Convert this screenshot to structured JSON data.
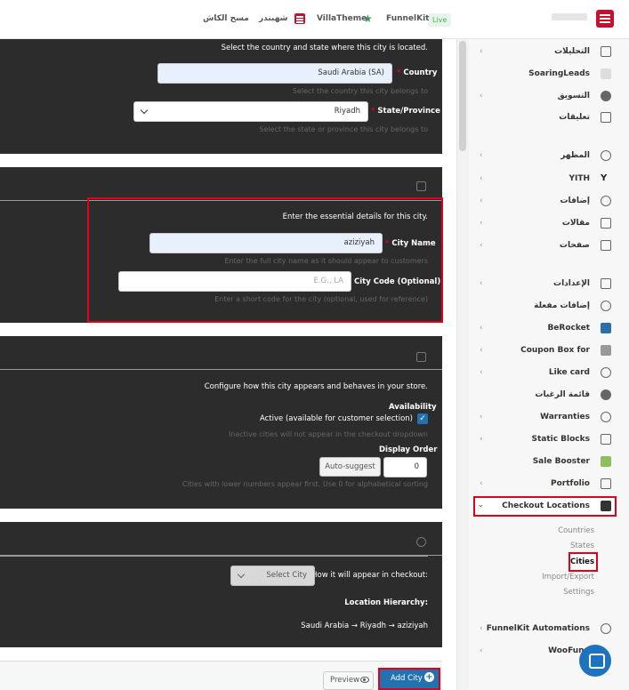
{
  "topbar": {
    "live_badge": "Live",
    "links": [
      "FunnelKit",
      "VillaTheme",
      "شهبندر",
      "مسح الكاش"
    ]
  },
  "sidebar": {
    "items": [
      {
        "label": "التحليلات",
        "icon": "analytics-icon"
      },
      {
        "label": "SoaringLeads",
        "icon": "soaringleads-icon"
      },
      {
        "label": "التسويق",
        "icon": "megaphone-icon"
      },
      {
        "label": "تعليقات",
        "icon": "comments-icon"
      },
      {
        "label": "المظهر",
        "icon": "appearance-icon"
      },
      {
        "label": "YITH",
        "icon": "yith-icon"
      },
      {
        "label": "إضافات",
        "icon": "plugins-icon"
      },
      {
        "label": "مقالات",
        "icon": "posts-icon"
      },
      {
        "label": "صفحات",
        "icon": "pages-icon"
      },
      {
        "label": "الإعدادات",
        "icon": "settings-icon"
      },
      {
        "label": "إضافات مفعلة",
        "icon": "active-plugins-icon"
      },
      {
        "label": "BeRocket",
        "icon": "berocket-icon"
      },
      {
        "label": "Coupon Box for",
        "icon": "coupon-icon"
      },
      {
        "label": "Like card",
        "icon": "gamepad-icon"
      },
      {
        "label": "قائمة الرغبات",
        "icon": "heart-icon"
      },
      {
        "label": "Warranties",
        "icon": "warranty-icon"
      },
      {
        "label": "Static Blocks",
        "icon": "blocks-icon"
      },
      {
        "label": "Sale Booster",
        "icon": "booster-icon"
      },
      {
        "label": "Portfolio",
        "icon": "portfolio-icon"
      },
      {
        "label": "Checkout Locations",
        "icon": "location-icon"
      },
      {
        "label": "FunnelKit Automations",
        "icon": "gear-icon"
      },
      {
        "label": "WooFunn",
        "icon": "woofunnels-icon"
      }
    ],
    "submenu": [
      "Countries",
      "States",
      "Cities",
      "Import/Export",
      "Settings"
    ]
  },
  "location_section": {
    "description": "Select the country and state where this city is located.",
    "country_label": "Country",
    "country_value": "Saudi Arabia (SA)",
    "country_help": "Select the country this city belongs to",
    "state_label": "State/Province",
    "state_value": "Riyadh",
    "state_help": "Select the state or province this city belongs to"
  },
  "details_section": {
    "description": "Enter the essential details for this city.",
    "city_name_label": "City Name",
    "city_name_value": "aziziyah",
    "city_name_help": "Enter the full city name as it should appear to customers",
    "city_code_label": "City Code (Optional)",
    "city_code_placeholder": "E.G., LA",
    "city_code_help": "Enter a short code for the city (optional, used for reference)"
  },
  "settings_section": {
    "description": "Configure how this city appears and behaves in your store.",
    "availability_label": "Availability",
    "active_label": "Active (available for customer selection)",
    "active_help": "Inactive cities will not appear in the checkout dropdown",
    "display_order_label": "Display Order",
    "display_order_value": "0",
    "auto_suggest_label": "Auto-suggest",
    "display_order_help": "Cities with lower numbers appear first. Use 0 for alphabetical sorting"
  },
  "preview_section": {
    "appear_label": "How it will appear in checkout:",
    "select_city_label": "Select City",
    "hierarchy_title": "Location Hierarchy:",
    "hierarchy_path": "Saudi Arabia → Riyadh → aziziyah"
  },
  "footer": {
    "preview_label": "Preview",
    "add_label": "Add City"
  }
}
